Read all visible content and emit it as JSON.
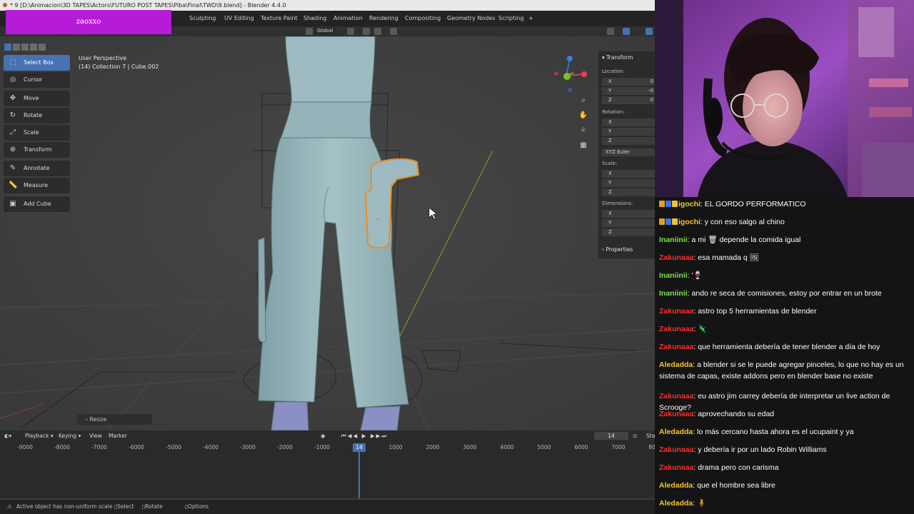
{
  "window": {
    "title": "* 9 [D:\\Animacion\\3D TAPES\\Actors\\FUTURO POST TAPES\\Piba\\Final\\TWD\\9.blend] - Blender 4.4.0"
  },
  "overlay": {
    "brand": "zaoxxo"
  },
  "workspaces": [
    "Sculpting",
    "UV Editing",
    "Texture Paint",
    "Shading",
    "Animation",
    "Rendering",
    "Compositing",
    "Geometry Nodes",
    "Scripting",
    "+"
  ],
  "header": {
    "orientation": "Global"
  },
  "toolbar": {
    "tools": [
      {
        "label": "Select Box",
        "icon": "select-box-icon",
        "glyph": "⬚"
      },
      {
        "label": "Cursor",
        "icon": "cursor-icon",
        "glyph": "◎"
      },
      {
        "label": "Move",
        "icon": "move-icon",
        "glyph": "✥"
      },
      {
        "label": "Rotate",
        "icon": "rotate-icon",
        "glyph": "↻"
      },
      {
        "label": "Scale",
        "icon": "scale-icon",
        "glyph": "⤢"
      },
      {
        "label": "Transform",
        "icon": "transform-icon",
        "glyph": "⊕"
      },
      {
        "label": "Annotate",
        "icon": "annotate-icon",
        "glyph": "✎"
      },
      {
        "label": "Measure",
        "icon": "measure-icon",
        "glyph": "📏"
      },
      {
        "label": "Add Cube",
        "icon": "add-cube-icon",
        "glyph": "▣"
      }
    ]
  },
  "viewport": {
    "view_name": "User Perspective",
    "collection": "(14) Collection 7 | Cube.002",
    "gizmo": {
      "x_color": "#e0455a",
      "y_color": "#7fbf2a",
      "z_color": "#3b7fe0"
    }
  },
  "npanel": {
    "transform_label": "Transform",
    "location_label": "Location:",
    "location": {
      "x": "0",
      "y": "-0",
      "z": "0"
    },
    "rotation_label": "Rotation:",
    "rotation_mode": "XYZ Euler",
    "scale_label": "Scale:",
    "dimensions_label": "Dimensions:",
    "properties_label": "Properties",
    "axes": [
      "X",
      "Y",
      "Z"
    ]
  },
  "operator_panel": {
    "label": "Resize"
  },
  "timeline": {
    "menus": [
      "Playback",
      "Keying",
      "View",
      "Marker"
    ],
    "current_frame": "14",
    "start_label": "Sta",
    "ruler": [
      "-9000",
      "-8000",
      "-7000",
      "-6000",
      "-5000",
      "-4000",
      "-3000",
      "-2000",
      "-1000",
      "14",
      "1000",
      "2000",
      "3000",
      "4000",
      "5000",
      "6000",
      "7000",
      "80"
    ]
  },
  "statusbar": {
    "message": "Active object has non-uniform scale",
    "hints": [
      "Select",
      "Rotate View",
      "Options"
    ]
  },
  "chat": {
    "messages": [
      {
        "user": "igochi",
        "text": "EL GORDO PERFORMATICO",
        "color": "#f3c532",
        "badges": true
      },
      {
        "user": "igochi",
        "text": "y con eso salgo al chino",
        "color": "#f3c532",
        "badges": true
      },
      {
        "user": "Inaniinii",
        "text": "a mi 🗑 depende la comida igual",
        "color": "#7ee04a",
        "badges": false
      },
      {
        "user": "Zakunaaa",
        "text": "esa mamada q 🖼",
        "color": "#ff2e2e",
        "badges": false
      },
      {
        "user": "Inaniinii",
        "text": "'🍷",
        "color": "#7ee04a",
        "badges": false
      },
      {
        "user": "Inaniinii",
        "text": "ando re seca de comisiones, estoy por entrar en un brote",
        "color": "#7ee04a",
        "badges": false
      },
      {
        "user": "Zakunaaa",
        "text": "astro top 5 herramientas de blender",
        "color": "#ff2e2e",
        "badges": false
      },
      {
        "user": "Zakunaaa",
        "text": "🦎",
        "color": "#ff2e2e",
        "badges": false
      },
      {
        "user": "Zakunaaa",
        "text": "que herramienta debería de tener blender a día de hoy",
        "color": "#ff2e2e",
        "badges": false
      },
      {
        "user": "Aledadda",
        "text": "a blender si se le puede agregar pinceles, lo que no hay es un sistema de capas, existe addons pero en blender base no existe",
        "color": "#f4c430",
        "badges": false
      },
      {
        "user": "Zakunaaa",
        "text": "eu astro jim carrey debería de interpretar un live action de Scrooge?",
        "color": "#ff2e2e",
        "badges": false
      },
      {
        "user": "Zakunaaa",
        "text": "aprovechando su edad",
        "color": "#ff2e2e",
        "badges": false
      },
      {
        "user": "Aledadda",
        "text": "lo más cercano hasta ahora es el ucupaint y ya",
        "color": "#f4c430",
        "badges": false
      },
      {
        "user": "Zakunaaa",
        "text": "y debería ir por un lado Robin Williams",
        "color": "#ff2e2e",
        "badges": false
      },
      {
        "user": "Zakunaaa",
        "text": "drama pero con carisma",
        "color": "#ff2e2e",
        "badges": false
      },
      {
        "user": "Aledadda",
        "text": "que el hombre sea libre",
        "color": "#f4c430",
        "badges": false
      },
      {
        "user": "Aledadda",
        "text": "🧍",
        "color": "#f4c430",
        "badges": false
      }
    ]
  }
}
